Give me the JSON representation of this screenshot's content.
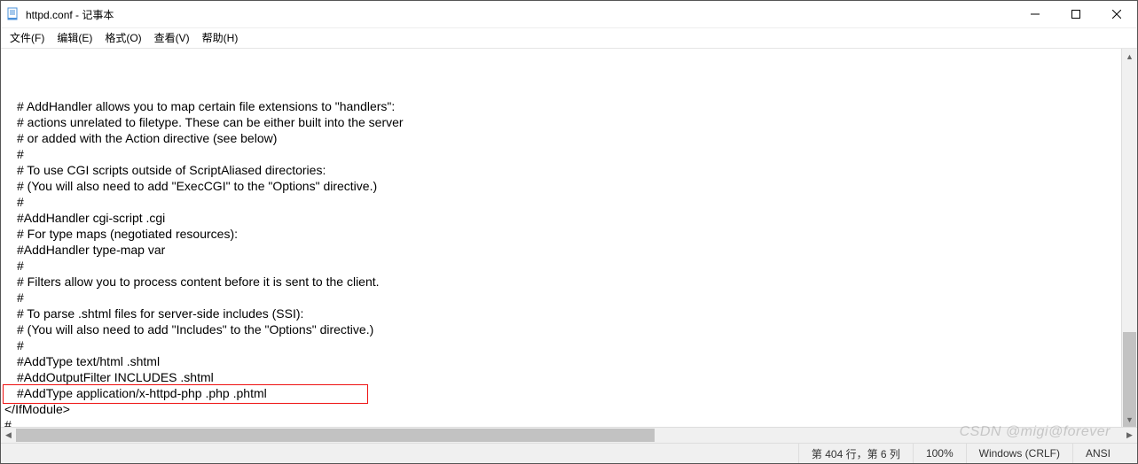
{
  "titlebar": {
    "title": "httpd.conf - 记事本"
  },
  "menu": {
    "file": "文件(F)",
    "edit": "编辑(E)",
    "format": "格式(O)",
    "view": "查看(V)",
    "help": "帮助(H)"
  },
  "lines": [
    "# AddHandler allows you to map certain file extensions to \"handlers\":",
    "# actions unrelated to filetype. These can be either built into the server",
    "# or added with the Action directive (see below)",
    "#",
    "# To use CGI scripts outside of ScriptAliased directories:",
    "# (You will also need to add \"ExecCGI\" to the \"Options\" directive.)",
    "#",
    "#AddHandler cgi-script .cgi",
    "",
    "# For type maps (negotiated resources):",
    "#AddHandler type-map var",
    "",
    "#",
    "# Filters allow you to process content before it is sent to the client.",
    "#",
    "# To parse .shtml files for server-side includes (SSI):",
    "# (You will also need to add \"Includes\" to the \"Options\" directive.)",
    "#",
    "#AddType text/html .shtml",
    "#AddOutputFilter INCLUDES .shtml",
    "#AddType application/x-httpd-php .php .phtml"
  ],
  "closing_lines": [
    "</IfModule>",
    "",
    "#"
  ],
  "status": {
    "position": "第 404 行，第 6 列",
    "zoom": "100%",
    "linebreak": "Windows (CRLF)",
    "encoding": "ANSI"
  },
  "watermark": "CSDN @migi@forever"
}
